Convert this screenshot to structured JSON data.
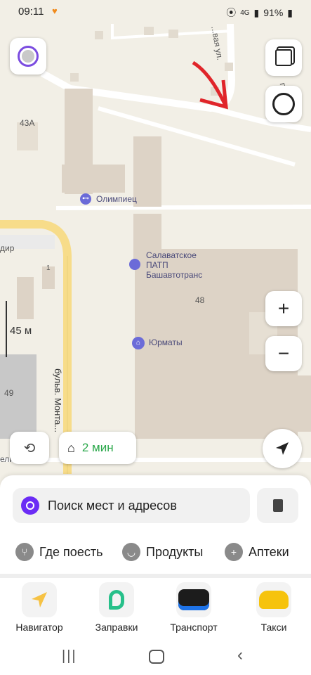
{
  "status": {
    "time": "09:11",
    "network": "4G",
    "battery": "91%"
  },
  "map": {
    "street_top": "...вая ул.",
    "street_right": "п",
    "house_43a": "43А",
    "poi_olimpiets": "Олимпиец",
    "poi_patp": "Салаватское ПАТП Башавтотранс",
    "poi_patp_line1": "Салаватское",
    "poi_patp_line2": "ПАТП",
    "poi_patp_line3": "Башавтотранс",
    "house_48": "48",
    "poi_yurmaty": "Юрматы",
    "label_dir": "дир",
    "house_1": "1",
    "house_49": "49",
    "scale": "45 м",
    "street_boulevard": "бульв. Монта...",
    "street_left_edge": "ели",
    "eta": "2 мин"
  },
  "sheet": {
    "search_placeholder": "Поиск мест и адресов",
    "categories": [
      {
        "label": "Где поесть",
        "icon": "fork-knife-icon"
      },
      {
        "label": "Продукты",
        "icon": "basket-icon"
      },
      {
        "label": "Аптеки",
        "icon": "plus-icon"
      }
    ]
  },
  "apps": [
    {
      "label": "Навигатор",
      "icon": "navigator-arrow-icon"
    },
    {
      "label": "Заправки",
      "icon": "fuel-icon"
    },
    {
      "label": "Транспорт",
      "icon": "bus-icon"
    },
    {
      "label": "Такси",
      "icon": "taxi-icon"
    }
  ],
  "colors": {
    "accent_green": "#2aa84a",
    "road_yellow": "#f7dc8a",
    "building": "#ddd3c6",
    "alice_purple": "#6b2cf5"
  }
}
